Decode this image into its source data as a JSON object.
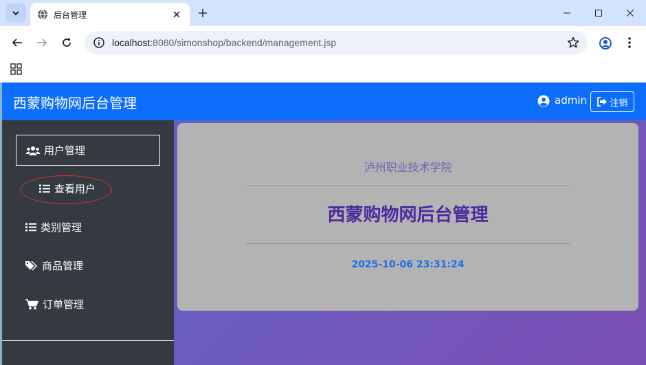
{
  "browser": {
    "tab_title": "后台管理",
    "url_host": "localhost",
    "url_rest": ":8080/simonshop/backend/management.jsp"
  },
  "app": {
    "brand": "西蒙购物网后台管理",
    "username": "admin",
    "logout_label": "注销"
  },
  "sidebar": {
    "items": [
      {
        "label": "用户管理"
      },
      {
        "label": "查看用户"
      },
      {
        "label": "类别管理"
      },
      {
        "label": "商品管理"
      },
      {
        "label": "订单管理"
      }
    ]
  },
  "main": {
    "school": "泸州职业技术学院",
    "title": "西蒙购物网后台管理",
    "datetime": "2025-10-06 23:31:24"
  },
  "colors": {
    "navbar": "#0d6efd",
    "sidebar": "#343a40",
    "title": "#4a2aa0",
    "datetime": "#1f6fe6",
    "annotation_circle": "#d9342b"
  }
}
